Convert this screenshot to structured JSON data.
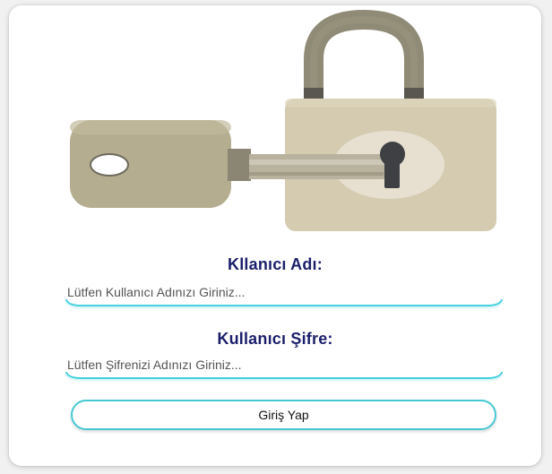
{
  "form": {
    "username_label": "Kllanıcı Adı:",
    "username_placeholder": "Lütfen Kullanıcı Adınızı Giriniz...",
    "username_value": "",
    "password_label": "Kullanıcı Şifre:",
    "password_placeholder": "Lütfen Şifrenizi Adınızı Giriniz...",
    "password_value": "",
    "submit_label": "Giriş Yap"
  },
  "icons": {
    "illustration": "padlock-with-key-icon"
  },
  "colors": {
    "label_text": "#1b1f6b",
    "accent_cyan": "#46d1dd",
    "lock_body": "#d4cbb0",
    "lock_shackle": "#8f8b76",
    "key_head": "#b5ad8f",
    "keyhole": "#3f4043"
  }
}
